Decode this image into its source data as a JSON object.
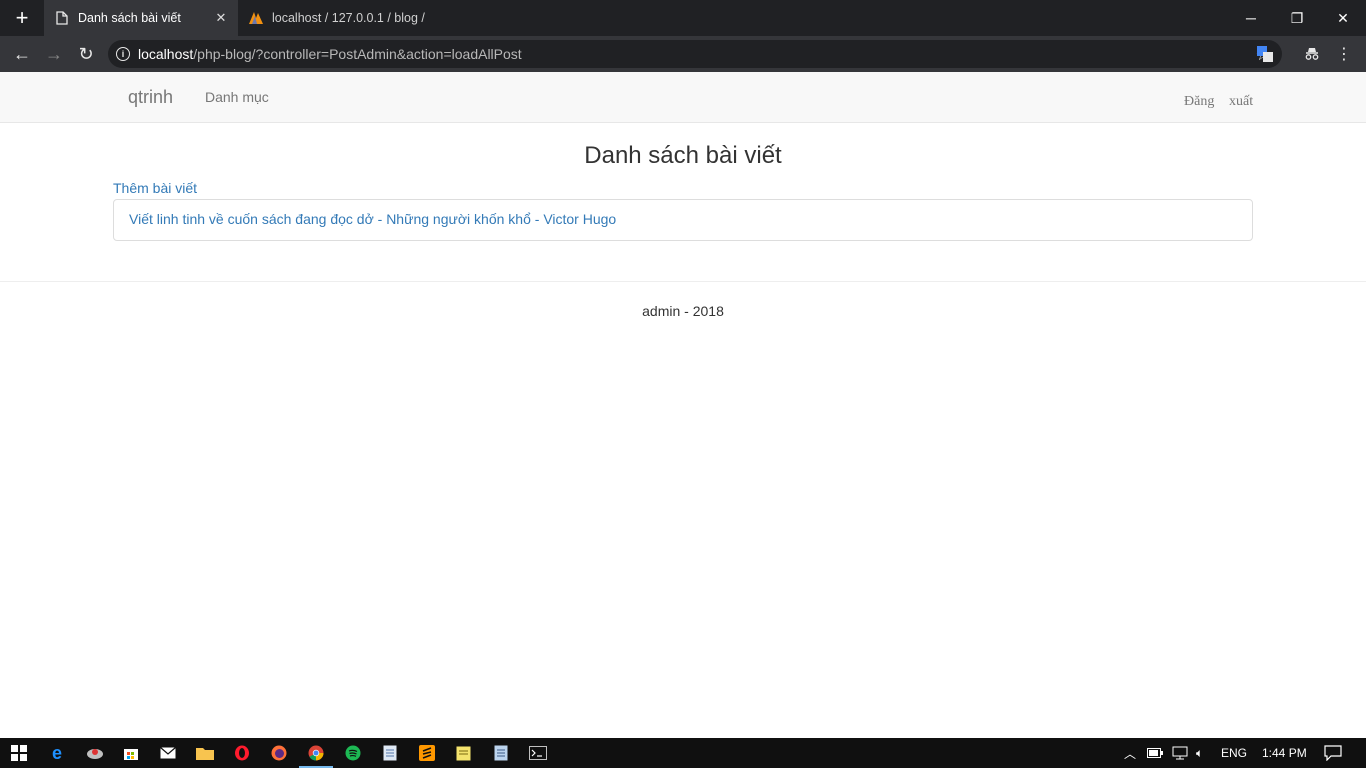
{
  "browser": {
    "tabs": [
      {
        "title": "Danh sách bài viết"
      },
      {
        "title": "localhost / 127.0.0.1 / blog /"
      }
    ],
    "url_host": "localhost",
    "url_path": "/php-blog/?controller=PostAdmin&action=loadAllPost"
  },
  "navbar": {
    "brand": "qtrinh",
    "nav_item": "Danh mục",
    "logout_word1": "Đăng",
    "logout_word2": "xuất"
  },
  "main": {
    "title": "Danh sách bài viết",
    "add_link": "Thêm bài viết",
    "posts": [
      {
        "title": "Viết linh tinh về cuốn sách đang đọc dở - Những người khốn khổ - Victor Hugo"
      }
    ]
  },
  "footer": {
    "text": "admin - 2018"
  },
  "taskbar": {
    "language": "ENG",
    "time": "1:44 PM"
  },
  "colors": {
    "link": "#337ab7",
    "navbar_bg": "#f8f8f8",
    "chrome_dark": "#202124",
    "chrome_tab": "#35363a"
  }
}
